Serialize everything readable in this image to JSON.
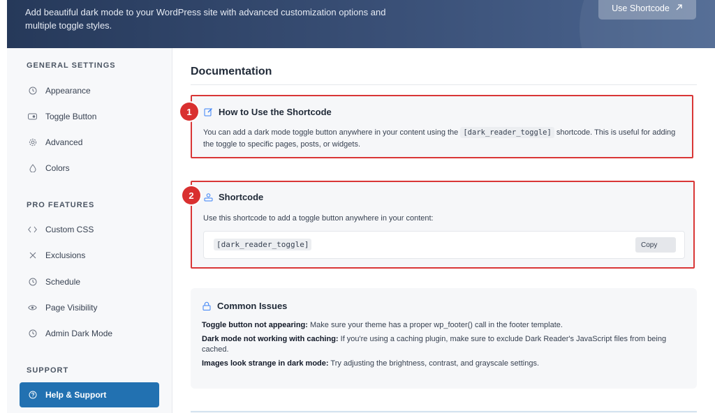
{
  "header": {
    "description": "Add beautiful dark mode to your WordPress site with advanced customization options and multiple toggle styles.",
    "use_shortcode_label": "Use Shortcode",
    "use_shortcode_icon": "external-arrow-icon"
  },
  "sidebar": {
    "general_label": "GENERAL SETTINGS",
    "general_items": [
      {
        "label": "Appearance",
        "icon": "clock-icon"
      },
      {
        "label": "Toggle Button",
        "icon": "toggle-icon"
      },
      {
        "label": "Advanced",
        "icon": "gear-icon"
      },
      {
        "label": "Colors",
        "icon": "droplet-icon"
      }
    ],
    "pro_label": "PRO FEATURES",
    "pro_items": [
      {
        "label": "Custom CSS",
        "icon": "code-icon"
      },
      {
        "label": "Exclusions",
        "icon": "x-icon"
      },
      {
        "label": "Schedule",
        "icon": "clock-icon"
      },
      {
        "label": "Page Visibility",
        "icon": "eye-icon"
      },
      {
        "label": "Admin Dark Mode",
        "icon": "clock-icon"
      }
    ],
    "support_label": "SUPPORT",
    "support_items": [
      {
        "label": "Help & Support",
        "icon": "question-circle-icon",
        "active": true
      }
    ]
  },
  "main": {
    "title": "Documentation",
    "how_to": {
      "badge": "1",
      "title": "How to Use the Shortcode",
      "text_before": "You can add a dark mode toggle button anywhere in your content using the",
      "code": "[dark_reader_toggle]",
      "text_after": "shortcode. This is useful for adding the toggle to specific pages, posts, or widgets."
    },
    "shortcode": {
      "badge": "2",
      "title": "Shortcode",
      "text": "Use this shortcode to add a toggle button anywhere in your content:",
      "code": "[dark_reader_toggle]",
      "copy_label": "Copy"
    },
    "common_issues": {
      "title": "Common Issues",
      "items": [
        {
          "bold": "Toggle button not appearing:",
          "text": " Make sure your theme has a proper wp_footer() call in the footer template."
        },
        {
          "bold": "Dark mode not working with caching:",
          "text": " If you're using a caching plugin, make sure to exclude Dark Reader's JavaScript files from being cached."
        },
        {
          "bold": "Images look strange in dark mode:",
          "text": " Try adjusting the brightness, contrast, and grayscale settings."
        }
      ]
    }
  },
  "colors": {
    "accent": "#2271b1",
    "highlight_border": "#d93636",
    "badge": "#d93030",
    "banner_start": "#26395a",
    "banner_end": "#4c6691"
  }
}
